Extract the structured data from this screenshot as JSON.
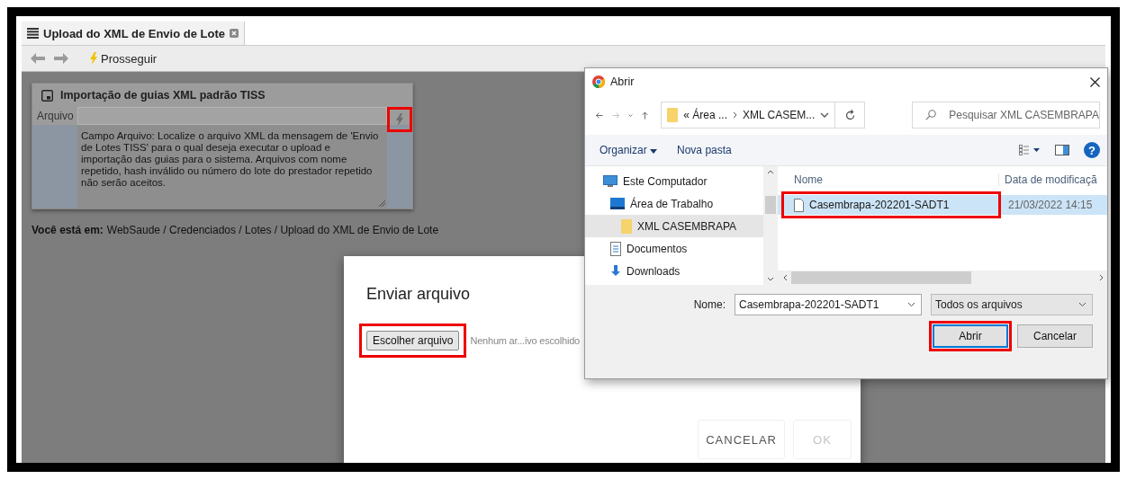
{
  "tab": {
    "title": "Upload do XML de Envio de Lote"
  },
  "toolbar": {
    "action": "Prosseguir"
  },
  "panel": {
    "title": "Importação de guias XML padrão TISS",
    "field_label": "Arquivo",
    "action_highlighted": true,
    "help": "Campo Arquivo: Localize o arquivo XML da mensagem de 'Envio de Lotes TISS' para o qual deseja executar o upload e importação das guias para o sistema. Arquivos com nome repetido, hash inválido ou número do lote do prestador repetido não serão aceitos."
  },
  "breadcrumb": {
    "label": "Você está em:",
    "path": "WebSaude / Credenciados / Lotes / Upload do XML de Envio de Lote"
  },
  "upload_modal": {
    "title": "Enviar arquivo",
    "choose_button": "Escolher arquivo",
    "choose_highlighted": true,
    "file_status": "Nenhum ar...ivo escolhido",
    "buttons": [
      {
        "label": "CANCELAR",
        "disabled": false
      },
      {
        "label": "OK",
        "disabled": true
      }
    ]
  },
  "file_dialog": {
    "title": "Abrir",
    "path": [
      "« Área ...",
      "XML CASEM..."
    ],
    "search_placeholder": "Pesquisar XML CASEMBRAPA",
    "help_icon": "?",
    "commands": [
      "Organizar",
      "Nova pasta"
    ],
    "nav": [
      {
        "label": "Este Computador",
        "kind": "computer",
        "selected": false,
        "children": [
          {
            "label": "Área de Trabalho",
            "kind": "desktop",
            "selected": false,
            "children": [
              {
                "label": "XML CASEMBRAPA",
                "kind": "folder",
                "selected": true
              }
            ]
          },
          {
            "label": "Documentos",
            "kind": "document",
            "selected": false
          },
          {
            "label": "Downloads",
            "kind": "download",
            "selected": false
          }
        ]
      }
    ],
    "columns": [
      "Nome",
      "Data de modificaçã"
    ],
    "files": [
      {
        "name": "Casembrapa-202201-SADT1",
        "date": "21/03/2022 14:15",
        "selected": true,
        "highlighted": true
      }
    ],
    "name_label": "Nome:",
    "name_value": "Casembrapa-202201-SADT1",
    "filter": "Todos os arquivos",
    "buttons": [
      {
        "label": "Abrir",
        "default": true,
        "highlighted": true
      },
      {
        "label": "Cancelar",
        "default": false,
        "highlighted": false
      }
    ]
  }
}
